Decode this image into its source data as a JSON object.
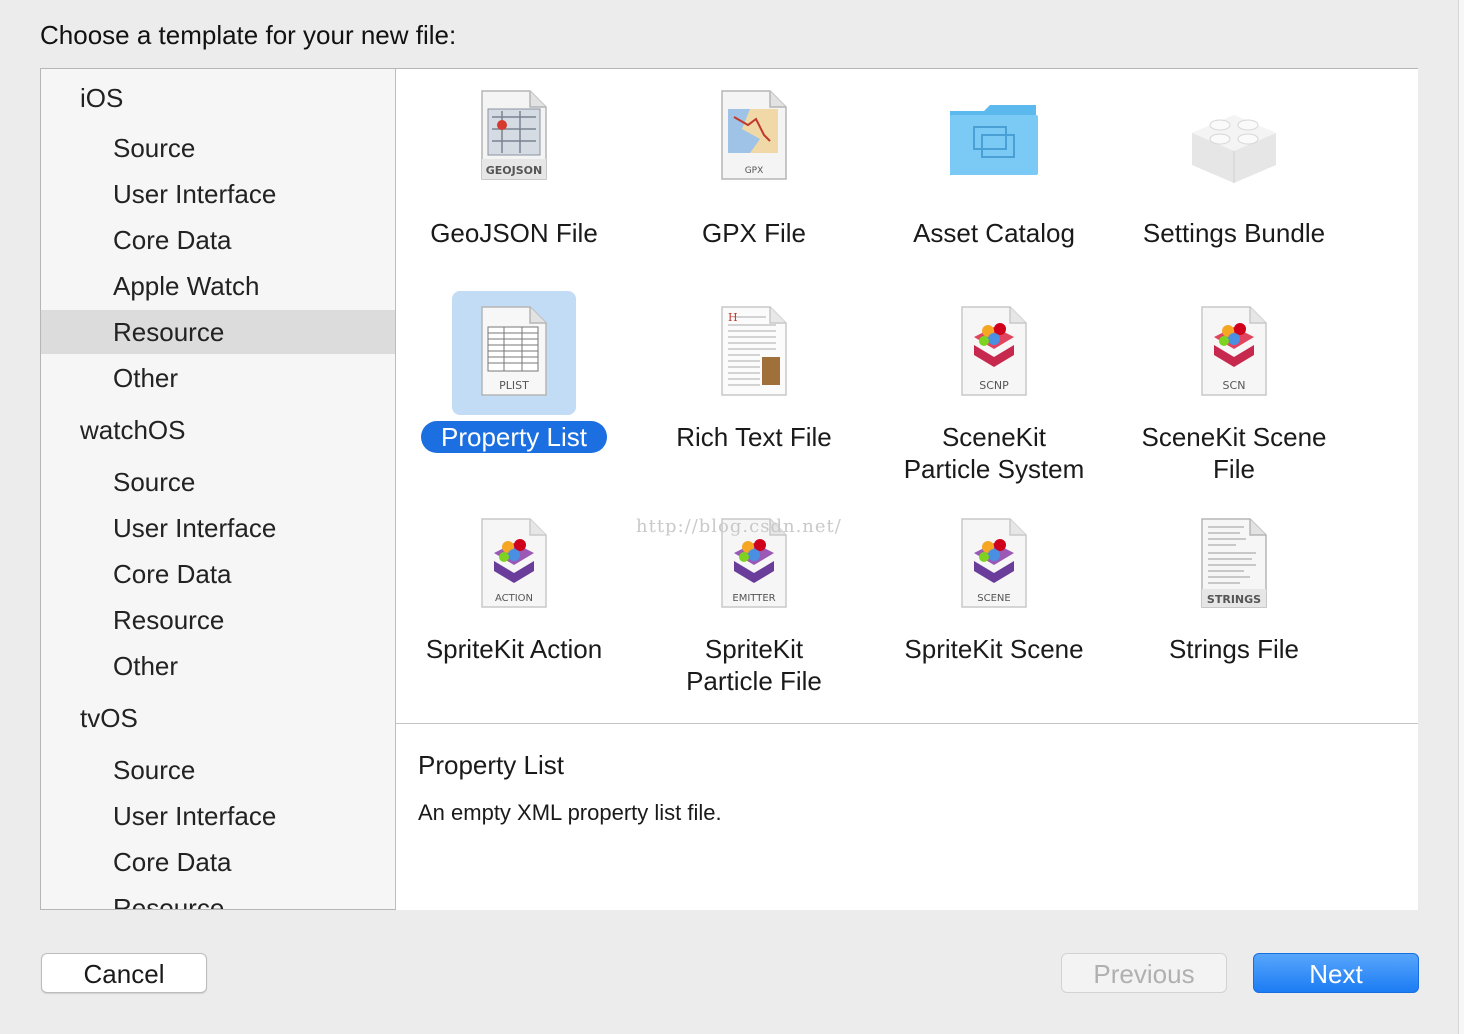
{
  "dialog": {
    "title": "Choose a template for your new file:"
  },
  "sidebar": {
    "groups": [
      {
        "platform": "iOS",
        "items": [
          "Source",
          "User Interface",
          "Core Data",
          "Apple Watch",
          "Resource",
          "Other"
        ]
      },
      {
        "platform": "watchOS",
        "items": [
          "Source",
          "User Interface",
          "Core Data",
          "Resource",
          "Other"
        ]
      },
      {
        "platform": "tvOS",
        "items": [
          "Source",
          "User Interface",
          "Core Data",
          "Resource"
        ]
      }
    ],
    "selected": "iOS / Resource"
  },
  "templates": [
    {
      "label": "GeoJSON File",
      "badge": "GEOJSON",
      "icon": "geojson-document-icon"
    },
    {
      "label": "GPX File",
      "badge": "GPX",
      "icon": "gpx-document-icon"
    },
    {
      "label": "Asset Catalog",
      "badge": "",
      "icon": "folder-icon"
    },
    {
      "label": "Settings Bundle",
      "badge": "",
      "icon": "lego-brick-icon"
    },
    {
      "label": "Property List",
      "badge": "PLIST",
      "icon": "plist-document-icon",
      "selected": true
    },
    {
      "label": "Rich Text File",
      "badge": "",
      "icon": "rich-text-document-icon"
    },
    {
      "label": "SceneKit Particle System",
      "label_lines": [
        "SceneKit",
        "Particle System"
      ],
      "badge": "SCNP",
      "icon": "scenekit-particle-icon"
    },
    {
      "label": "SceneKit Scene File",
      "label_lines": [
        "SceneKit Scene",
        "File"
      ],
      "badge": "SCN",
      "icon": "scenekit-scene-icon"
    },
    {
      "label": "SpriteKit Action",
      "badge": "ACTION",
      "icon": "spritekit-action-icon"
    },
    {
      "label": "SpriteKit Particle File",
      "label_lines": [
        "SpriteKit",
        "Particle File"
      ],
      "badge": "EMITTER",
      "icon": "spritekit-emitter-icon"
    },
    {
      "label": "SpriteKit Scene",
      "badge": "SCENE",
      "icon": "spritekit-scene-icon"
    },
    {
      "label": "Strings File",
      "badge": "STRINGS",
      "icon": "strings-document-icon"
    }
  ],
  "detail": {
    "title": "Property List",
    "description": "An empty XML property list file."
  },
  "buttons": {
    "cancel": "Cancel",
    "previous": "Previous",
    "next": "Next"
  },
  "watermark": "http://blog.csdn.net/",
  "colors": {
    "accent": "#1b6fe0",
    "selected_tile_bg": "#c3dcf5",
    "sidebar_selected": "#dcdcdc"
  }
}
